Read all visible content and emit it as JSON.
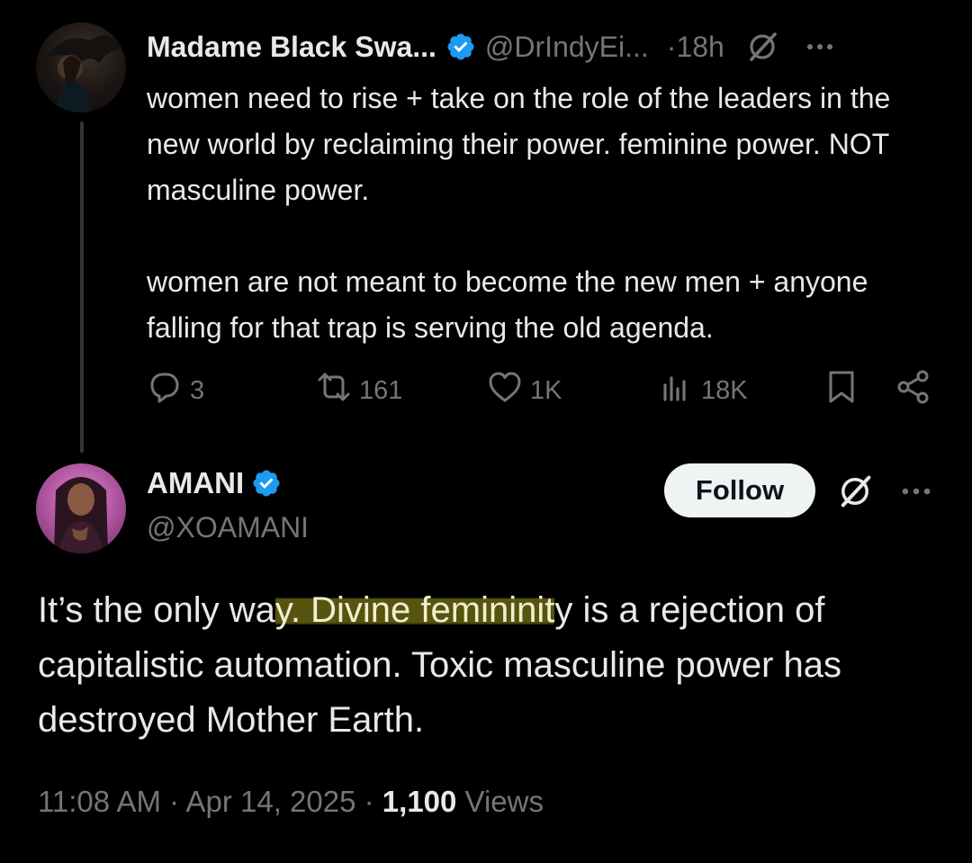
{
  "colors": {
    "background": "#000000",
    "text_primary": "#e7e9ea",
    "text_secondary": "#71767b",
    "verified_blue": "#1d9bf0",
    "highlight": "#706c14"
  },
  "parent_tweet": {
    "display_name": "Madame Black Swa...",
    "handle": "@DrIndyEi...",
    "separator": "·",
    "time": "18h",
    "paragraph1": "women need to rise + take on the role of the leaders in the new world by reclaiming their power. feminine power. NOT masculine power.",
    "paragraph2": "women are not meant to become the new men + anyone falling for that trap is serving the old agenda.",
    "actions": {
      "replies": "3",
      "reposts": "161",
      "likes": "1K",
      "views": "18K"
    },
    "icons": [
      "verified-badge-icon",
      "grok-icon",
      "more-icon",
      "reply-icon",
      "repost-icon",
      "like-icon",
      "views-icon",
      "bookmark-icon",
      "share-icon"
    ]
  },
  "reply_tweet": {
    "display_name": "AMANI",
    "handle": "@XOAMANI",
    "follow_label": "Follow",
    "text_before": "It’s the only wa",
    "text_highlight": "y. Divine femininit",
    "text_after": "y is a rejection of capitalistic automation. Toxic masculine power has destroyed Mother Earth.",
    "timestamp": "11:08 AM · Apr 14, 2025 · ",
    "views_count": "1,100",
    "views_label": " Views"
  }
}
